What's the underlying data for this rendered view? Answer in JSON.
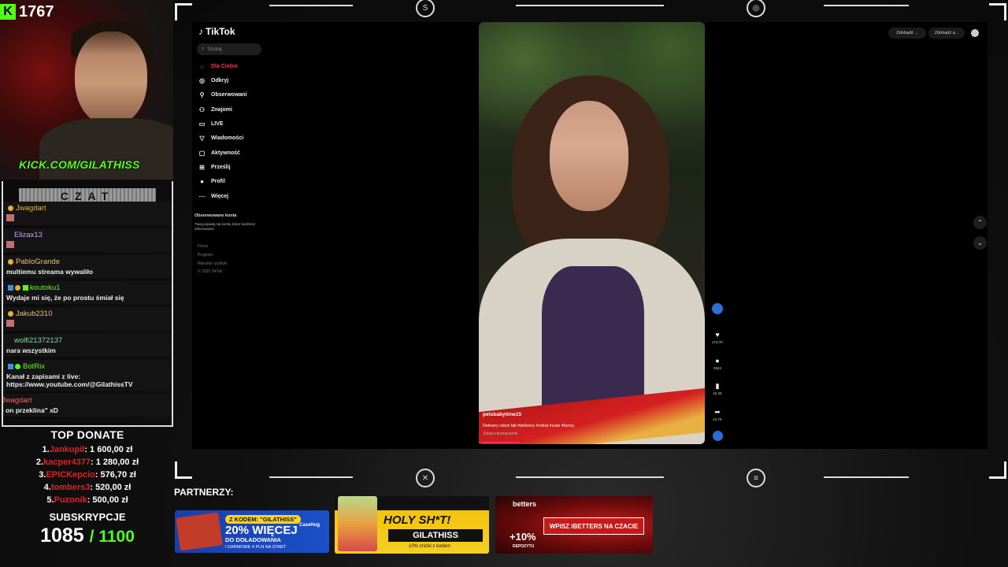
{
  "stream": {
    "kick_count": "1767",
    "kick_url": "KICK.COM/GILATHISS",
    "chat_title": "CZAT"
  },
  "chat": [
    {
      "user": "Jwagdart",
      "color": "#e8b030",
      "text": ""
    },
    {
      "user": "Elizax13",
      "color": "#c9a0ff",
      "text": ""
    },
    {
      "user": "PabloGrande",
      "color": "#e8c070",
      "text": "multiemu streama wywaliło"
    },
    {
      "user": "koutoku1",
      "color": "#53fc18",
      "text": "Wydaje mi się, że po prostu śmiał się"
    },
    {
      "user": "Jakub2310",
      "color": "#e8c070",
      "text": ""
    },
    {
      "user": "wolfi21372137",
      "color": "#7fd8a0",
      "text": "nara wszystkim"
    },
    {
      "user": "BotRix",
      "color": "#53fc18",
      "text": "Kanał z zapisami z live: https://www.youtube.com/@GilathissTV"
    },
    {
      "user": "Jwagdart",
      "color": "#ff6060",
      "text": "e on przeklina\" xD"
    }
  ],
  "donate": {
    "title": "TOP DONATE",
    "items": [
      {
        "rank": "1.",
        "name": "Jankopil",
        "amount": ": 1 600,00 zł"
      },
      {
        "rank": "2.",
        "name": "kacper4377",
        "amount": ": 1 280,00 zł"
      },
      {
        "rank": "3.",
        "name": "EPICKepcio",
        "amount": ": 576,70 zł"
      },
      {
        "rank": "4.",
        "name": "tombers3",
        "amount": ": 520,00 zł"
      },
      {
        "rank": "5.",
        "name": "Puzonik",
        "amount": ": 500,00 zł"
      }
    ],
    "subs_title": "SUBSKRYPCJE",
    "subs_count": "1085",
    "subs_goal": "/ 1100"
  },
  "tiktok": {
    "logo": "TikTok",
    "search_placeholder": "Szukaj",
    "nav": [
      {
        "label": "Dla Ciebie",
        "icon": "home-icon",
        "active": true
      },
      {
        "label": "Odkryj",
        "icon": "compass-icon"
      },
      {
        "label": "Obserwowani",
        "icon": "following-icon"
      },
      {
        "label": "Znajomi",
        "icon": "friends-icon"
      },
      {
        "label": "LIVE",
        "icon": "live-icon"
      },
      {
        "label": "Wiadomości",
        "icon": "messages-icon"
      },
      {
        "label": "Aktywność",
        "icon": "activity-icon"
      },
      {
        "label": "Prześlij",
        "icon": "upload-icon"
      },
      {
        "label": "Profil",
        "icon": "profile-icon"
      },
      {
        "label": "Więcej",
        "icon": "more-icon"
      }
    ],
    "following_header": "Obserwowane konta",
    "following_text": "Tutaj pojawią się konta, które będziesz obserwować",
    "footer": [
      "Firma",
      "Program",
      "Warunki i polityki",
      "© 2025 TikTok"
    ],
    "top_right": [
      "Zdobądź ...",
      "Zdobądź a..."
    ],
    "video": {
      "user": "petsbabytime15",
      "description": "Delivery robot fail #delivery #robot #cute #funny",
      "translate": "Zobacz tłumaczenie",
      "progress": 0.18
    },
    "actions": [
      {
        "icon": "heart-icon",
        "count": "173,7K"
      },
      {
        "icon": "comment-icon",
        "count": "2542"
      },
      {
        "icon": "bookmark-icon",
        "count": "15,3K"
      },
      {
        "icon": "share-icon",
        "count": "44,7K"
      }
    ]
  },
  "partners": {
    "label": "PARTNERZY:",
    "b1": {
      "pill": "Z KODEM: \"GILATHISS\"",
      "big": "20% WIĘCEJ",
      "small": "DO DOŁADOWANIA",
      "tiny": "I DARMOWE 4 PLN NA START",
      "brand": "CaseHug"
    },
    "b2": {
      "title": "HOLY SH*T!",
      "code": "GILATHISS",
      "sub": "10% zniżki z kodem"
    },
    "b3": {
      "brand": "betters",
      "cta": "WPISZ IBETTERS NA CZACIE",
      "pct": "+10%",
      "dep": "DEPOZYTU"
    }
  }
}
